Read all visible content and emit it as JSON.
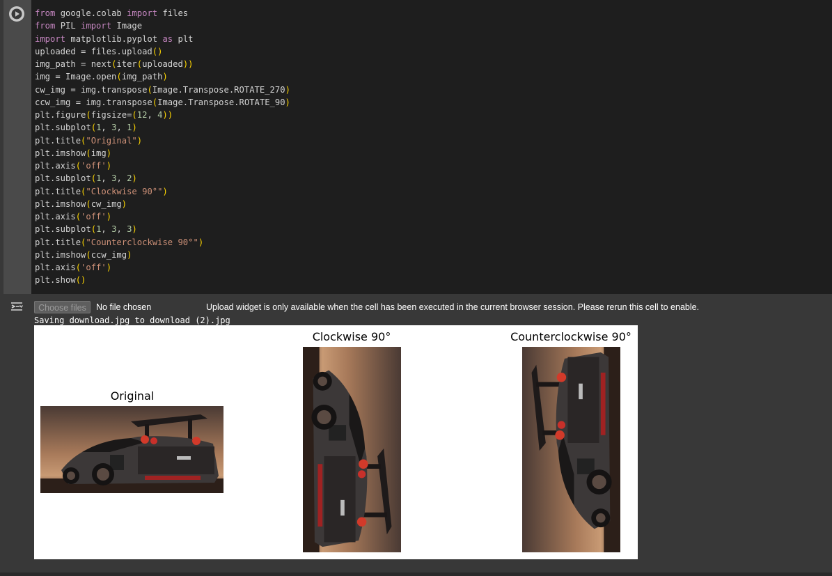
{
  "code_cell": {
    "run_button_icon": "play-icon",
    "lines": [
      [
        [
          "kw",
          "from"
        ],
        [
          "t",
          " google.colab "
        ],
        [
          "kw",
          "import"
        ],
        [
          "t",
          " files"
        ]
      ],
      [
        [
          "kw",
          "from"
        ],
        [
          "t",
          " PIL "
        ],
        [
          "kw",
          "import"
        ],
        [
          "t",
          " Image"
        ]
      ],
      [
        [
          "kw",
          "import"
        ],
        [
          "t",
          " matplotlib.pyplot "
        ],
        [
          "kw",
          "as"
        ],
        [
          "t",
          " plt"
        ]
      ],
      [
        [
          "t",
          "uploaded = files.upload"
        ],
        [
          "p",
          "()"
        ]
      ],
      [
        [
          "t",
          "img_path = next"
        ],
        [
          "p",
          "("
        ],
        [
          "t",
          "iter"
        ],
        [
          "p",
          "("
        ],
        [
          "t",
          "uploaded"
        ],
        [
          "p",
          "))"
        ]
      ],
      [
        [
          "t",
          "img = Image.open"
        ],
        [
          "p",
          "("
        ],
        [
          "t",
          "img_path"
        ],
        [
          "p",
          ")"
        ]
      ],
      [
        [
          "t",
          "cw_img = img.transpose"
        ],
        [
          "p",
          "("
        ],
        [
          "t",
          "Image.Transpose.ROTATE_270"
        ],
        [
          "p",
          ")"
        ]
      ],
      [
        [
          "t",
          "ccw_img = img.transpose"
        ],
        [
          "p",
          "("
        ],
        [
          "t",
          "Image.Transpose.ROTATE_90"
        ],
        [
          "p",
          ")"
        ]
      ],
      [
        [
          "t",
          "plt.figure"
        ],
        [
          "p",
          "("
        ],
        [
          "t",
          "figsize="
        ],
        [
          "p",
          "("
        ],
        [
          "n",
          "12"
        ],
        [
          "t",
          ", "
        ],
        [
          "n",
          "4"
        ],
        [
          "p",
          "))"
        ]
      ],
      [
        [
          "t",
          "plt.subplot"
        ],
        [
          "p",
          "("
        ],
        [
          "n",
          "1"
        ],
        [
          "t",
          ", "
        ],
        [
          "n",
          "3"
        ],
        [
          "t",
          ", "
        ],
        [
          "n",
          "1"
        ],
        [
          "p",
          ")"
        ]
      ],
      [
        [
          "t",
          "plt.title"
        ],
        [
          "p",
          "("
        ],
        [
          "s",
          "\"Original\""
        ],
        [
          "p",
          ")"
        ]
      ],
      [
        [
          "t",
          "plt.imshow"
        ],
        [
          "p",
          "("
        ],
        [
          "t",
          "img"
        ],
        [
          "p",
          ")"
        ]
      ],
      [
        [
          "t",
          "plt.axis"
        ],
        [
          "p",
          "("
        ],
        [
          "s",
          "'off'"
        ],
        [
          "p",
          ")"
        ]
      ],
      [
        [
          "t",
          "plt.subplot"
        ],
        [
          "p",
          "("
        ],
        [
          "n",
          "1"
        ],
        [
          "t",
          ", "
        ],
        [
          "n",
          "3"
        ],
        [
          "t",
          ", "
        ],
        [
          "n",
          "2"
        ],
        [
          "p",
          ")"
        ]
      ],
      [
        [
          "t",
          "plt.title"
        ],
        [
          "p",
          "("
        ],
        [
          "s",
          "\"Clockwise 90°\""
        ],
        [
          "p",
          ")"
        ]
      ],
      [
        [
          "t",
          "plt.imshow"
        ],
        [
          "p",
          "("
        ],
        [
          "t",
          "cw_img"
        ],
        [
          "p",
          ")"
        ]
      ],
      [
        [
          "t",
          "plt.axis"
        ],
        [
          "p",
          "("
        ],
        [
          "s",
          "'off'"
        ],
        [
          "p",
          ")"
        ]
      ],
      [
        [
          "t",
          "plt.subplot"
        ],
        [
          "p",
          "("
        ],
        [
          "n",
          "1"
        ],
        [
          "t",
          ", "
        ],
        [
          "n",
          "3"
        ],
        [
          "t",
          ", "
        ],
        [
          "n",
          "3"
        ],
        [
          "p",
          ")"
        ]
      ],
      [
        [
          "t",
          "plt.title"
        ],
        [
          "p",
          "("
        ],
        [
          "s",
          "\"Counterclockwise 90°\""
        ],
        [
          "p",
          ")"
        ]
      ],
      [
        [
          "t",
          "plt.imshow"
        ],
        [
          "p",
          "("
        ],
        [
          "t",
          "ccw_img"
        ],
        [
          "p",
          ")"
        ]
      ],
      [
        [
          "t",
          "plt.axis"
        ],
        [
          "p",
          "("
        ],
        [
          "s",
          "'off'"
        ],
        [
          "p",
          ")"
        ]
      ],
      [
        [
          "t",
          "plt.show"
        ],
        [
          "p",
          "()"
        ]
      ]
    ]
  },
  "output": {
    "output_icon": "output-toggle-icon",
    "choose_files_label": "Choose files",
    "no_file_label": "No file chosen",
    "upload_message": "Upload widget is only available when the cell has been executed in the current browser session. Please rerun this cell to enable.",
    "saving_text": "Saving download.jpg to download (2).jpg",
    "figure": {
      "panels": [
        {
          "title": "Original",
          "rotation": "none"
        },
        {
          "title": "Clockwise 90°",
          "rotation": "cw"
        },
        {
          "title": "Counterclockwise 90°",
          "rotation": "ccw"
        }
      ]
    }
  },
  "colors": {
    "editor_bg": "#1e1e1e",
    "keyword": "#c586c0",
    "bracket": "#ffd700",
    "string": "#ce9178",
    "number": "#b5cea8"
  }
}
